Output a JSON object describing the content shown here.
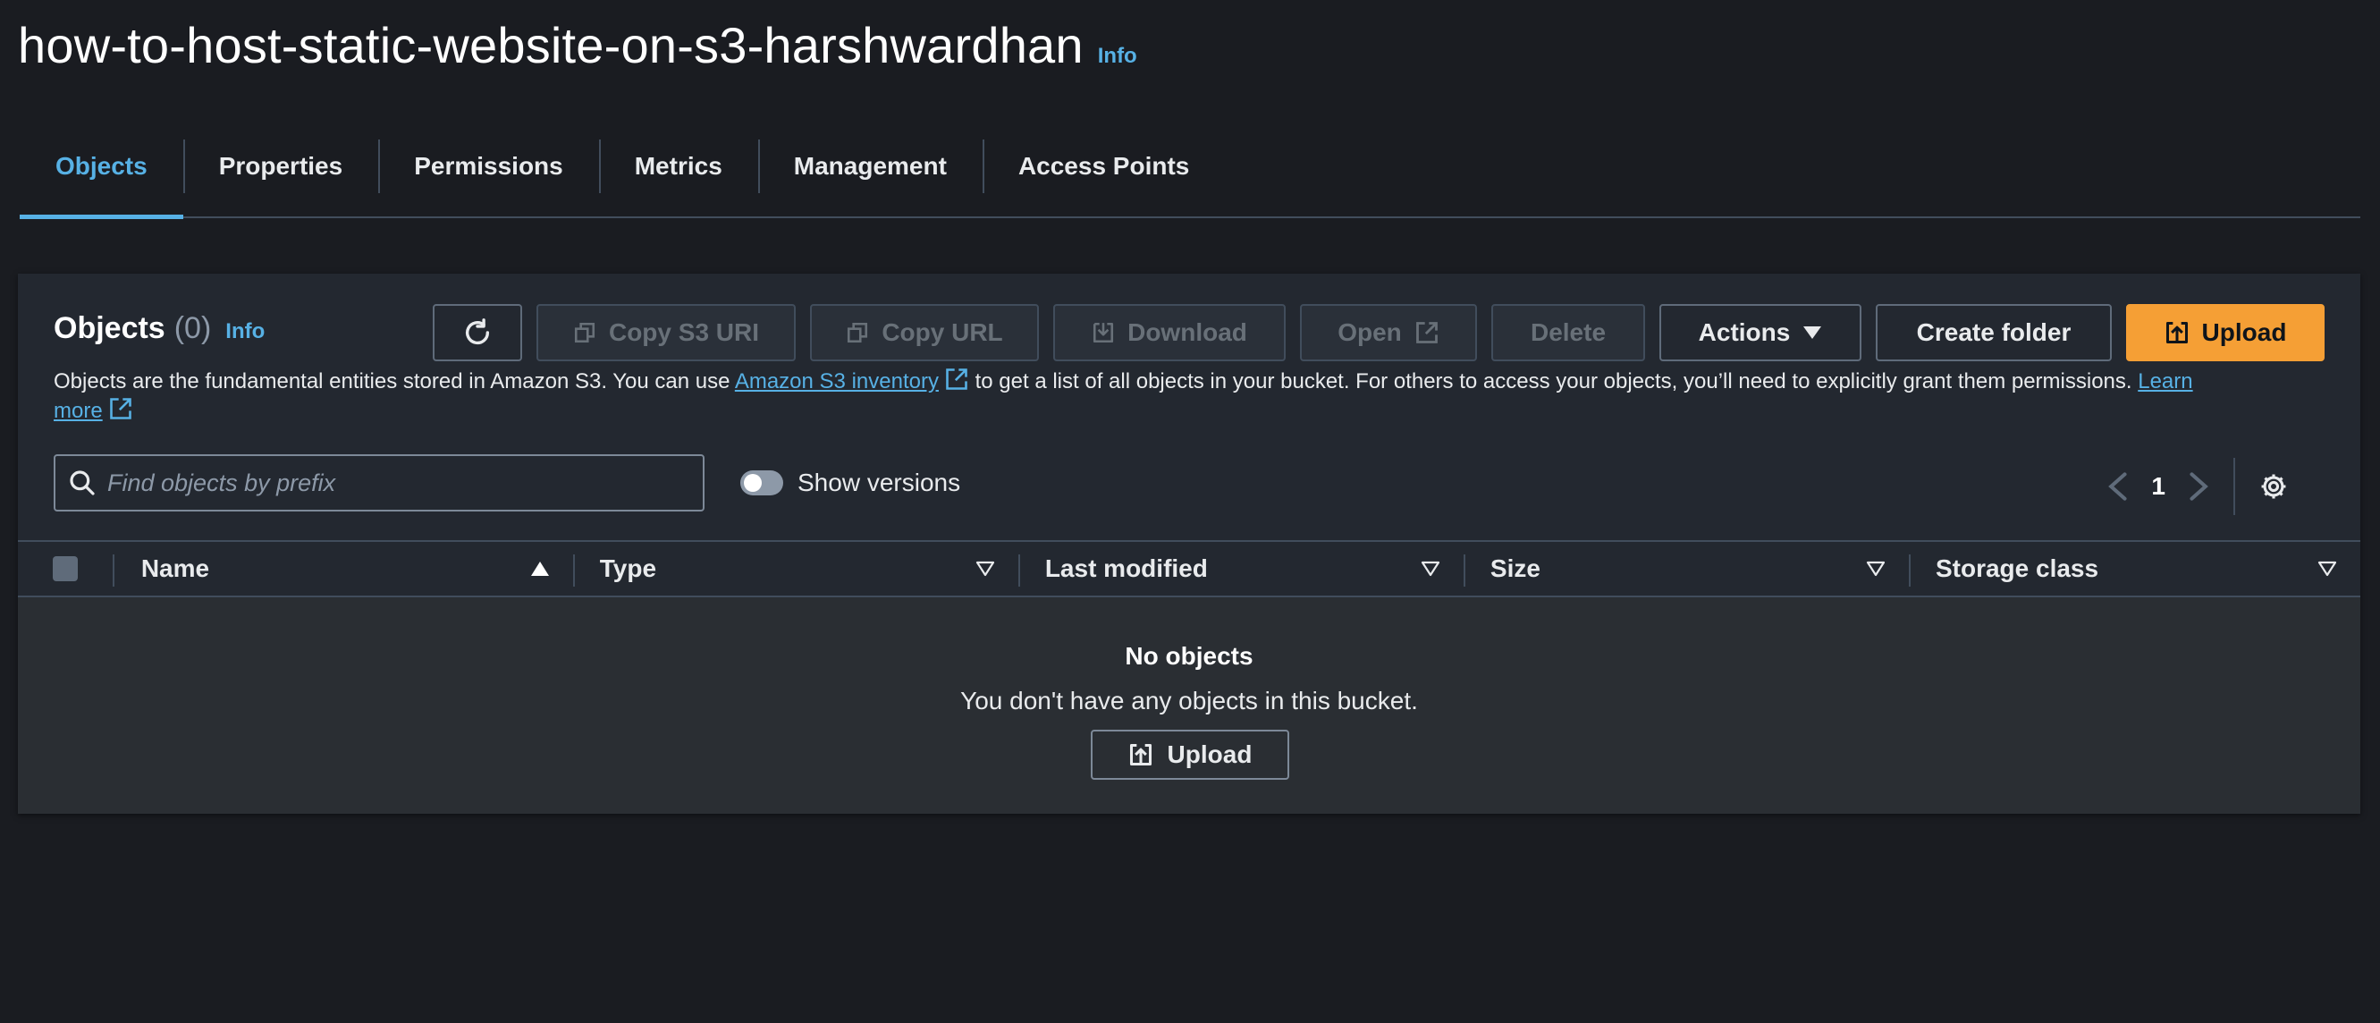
{
  "header": {
    "bucket_name": "how-to-host-static-website-on-s3-harshwardhan",
    "info_label": "Info"
  },
  "tabs": [
    {
      "label": "Objects",
      "active": true
    },
    {
      "label": "Properties"
    },
    {
      "label": "Permissions"
    },
    {
      "label": "Metrics"
    },
    {
      "label": "Management"
    },
    {
      "label": "Access Points"
    }
  ],
  "objects_panel": {
    "title": "Objects",
    "count": "(0)",
    "info_label": "Info",
    "toolbar": {
      "refresh_icon": "refresh-icon",
      "copy_s3_uri": "Copy S3 URI",
      "copy_url": "Copy URL",
      "download": "Download",
      "open": "Open",
      "delete": "Delete",
      "actions": "Actions",
      "create_folder": "Create folder",
      "upload": "Upload"
    },
    "description": {
      "part1": "Objects are the fundamental entities stored in Amazon S3. You can use ",
      "link1": "Amazon S3 inventory",
      "part2": " to get a list of all objects in your bucket. For others to access your objects, you’ll need to explicitly grant them permissions. ",
      "link2_line1": "Learn",
      "link2_line2": "more"
    },
    "search": {
      "placeholder": "Find objects by prefix",
      "value": ""
    },
    "show_versions_label": "Show versions",
    "show_versions_on": false,
    "pagination": {
      "current_page": "1"
    },
    "columns": [
      {
        "label": "Name",
        "sort": "ascending"
      },
      {
        "label": "Type"
      },
      {
        "label": "Last modified"
      },
      {
        "label": "Size"
      },
      {
        "label": "Storage class"
      }
    ],
    "empty_state": {
      "title": "No objects",
      "message": "You don't have any objects in this bucket.",
      "upload_label": "Upload"
    }
  },
  "colors": {
    "background": "#1a1c21",
    "panel": "#232830",
    "accent_link": "#57b1e5",
    "primary_button": "#f59f35"
  }
}
